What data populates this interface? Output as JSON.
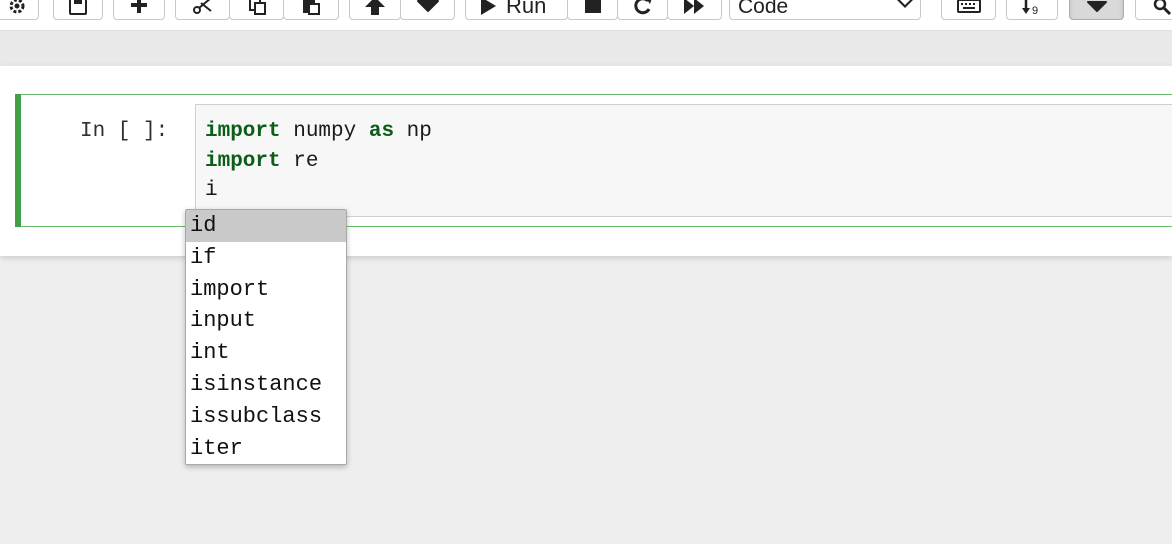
{
  "toolbar": {
    "run_label": "Run",
    "cell_type_selected": "Code",
    "icons": [
      "gear-icon",
      "save-icon",
      "plus-icon",
      "cut-icon",
      "copy-icon",
      "paste-icon",
      "move-up-icon",
      "move-down-icon",
      "play-icon",
      "stop-icon",
      "restart-icon",
      "fast-forward-icon",
      "chevron-down-icon",
      "keyboard-icon",
      "sort-numeric-icon",
      "dropdown-chevron-icon"
    ]
  },
  "cell": {
    "prompt": "In [ ]:",
    "code_lines": [
      [
        {
          "text": "import",
          "kw": true
        },
        {
          "text": " numpy ",
          "kw": false
        },
        {
          "text": "as",
          "kw": true
        },
        {
          "text": " np",
          "kw": false
        }
      ],
      [
        {
          "text": "import",
          "kw": true
        },
        {
          "text": " re",
          "kw": false
        }
      ],
      [
        {
          "text": "i",
          "kw": false
        }
      ]
    ]
  },
  "completer": {
    "items": [
      "id",
      "if",
      "import",
      "input",
      "int",
      "isinstance",
      "issubclass",
      "iter"
    ],
    "selected_index": 0
  },
  "colors": {
    "keyword": "#0b5d18",
    "cell_border": "#66bb6a",
    "cell_bar": "#42a047",
    "editor_bg": "#f7f7f7",
    "selected_item": "#c9c9c9"
  }
}
